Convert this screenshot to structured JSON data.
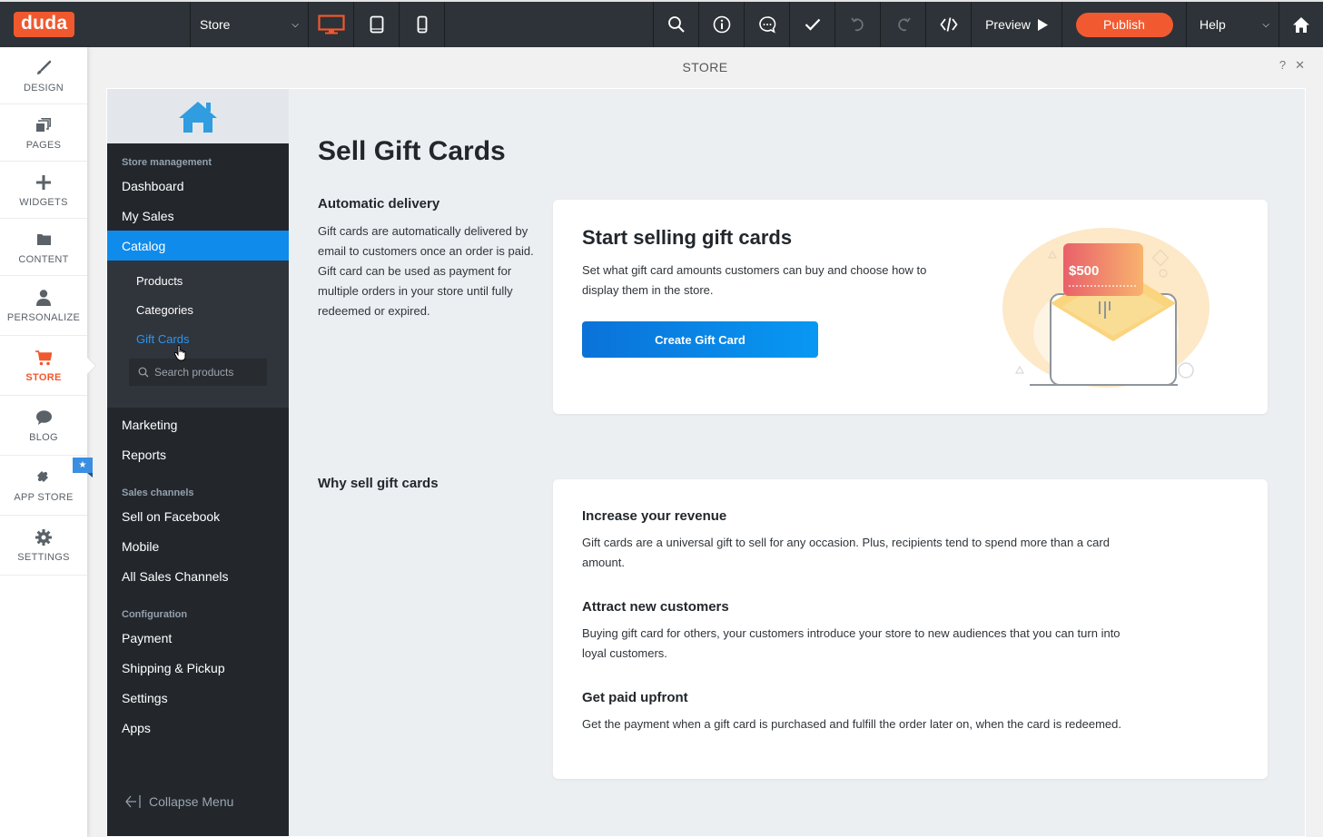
{
  "topbar": {
    "logo": "duda",
    "page_select": "Store",
    "device_buttons": [
      {
        "name": "desktop",
        "active": true
      },
      {
        "name": "tablet",
        "active": false
      },
      {
        "name": "mobile",
        "active": false
      }
    ],
    "tools": [
      "search",
      "info",
      "comments",
      "check",
      "undo",
      "redo",
      "code"
    ],
    "preview_label": "Preview",
    "publish_label": "Publish",
    "help_label": "Help",
    "accent_color": "#f0582e"
  },
  "rail": {
    "items": [
      {
        "label": "DESIGN",
        "icon": "brush-icon"
      },
      {
        "label": "PAGES",
        "icon": "pages-icon"
      },
      {
        "label": "WIDGETS",
        "icon": "plus-icon"
      },
      {
        "label": "CONTENT",
        "icon": "folder-icon"
      },
      {
        "label": "PERSONALIZE",
        "icon": "person-icon"
      },
      {
        "label": "STORE",
        "icon": "cart-icon",
        "active": true
      },
      {
        "label": "BLOG",
        "icon": "speech-bubble-icon"
      },
      {
        "label": "APP STORE",
        "icon": "puzzle-icon"
      },
      {
        "label": "SETTINGS",
        "icon": "gear-icon"
      }
    ]
  },
  "panel": {
    "title": "STORE",
    "help": "?",
    "close": "✕"
  },
  "store_menu": {
    "groups": [
      {
        "label": "Store management"
      },
      {
        "label": "Sales channels"
      },
      {
        "label": "Configuration"
      }
    ],
    "management": [
      "Dashboard",
      "My Sales",
      "Catalog"
    ],
    "catalog_sub": [
      "Products",
      "Categories",
      "Gift Cards"
    ],
    "search_placeholder": "Search products",
    "after_catalog": [
      "Marketing",
      "Reports"
    ],
    "sales_channels": [
      "Sell on Facebook",
      "Mobile",
      "All Sales Channels"
    ],
    "configuration": [
      "Payment",
      "Shipping & Pickup",
      "Settings",
      "Apps"
    ],
    "collapse_label": "Collapse Menu"
  },
  "main": {
    "title": "Sell Gift Cards",
    "auto_title": "Automatic delivery",
    "auto_text": "Gift cards are automatically delivered by email to customers once an order is paid. Gift card can be used as payment for multiple orders in your store until fully redeemed or expired.",
    "start_card": {
      "title": "Start selling gift cards",
      "text": "Set what gift card amounts customers can buy and choose how to display them in the store.",
      "button": "Create Gift Card",
      "illustration_amount": "$500"
    },
    "why_title": "Why sell gift cards",
    "benefits": [
      {
        "title": "Increase your revenue",
        "text": "Gift cards are a universal gift to sell for any occasion. Plus, recipients tend to spend more than a card amount."
      },
      {
        "title": "Attract new customers",
        "text": "Buying gift card for others, your customers introduce your store to new audiences that you can turn into loyal customers."
      },
      {
        "title": "Get paid upfront",
        "text": "Get the payment when a gift card is purchased and fulfill the order later on, when the card is redeemed."
      }
    ]
  }
}
